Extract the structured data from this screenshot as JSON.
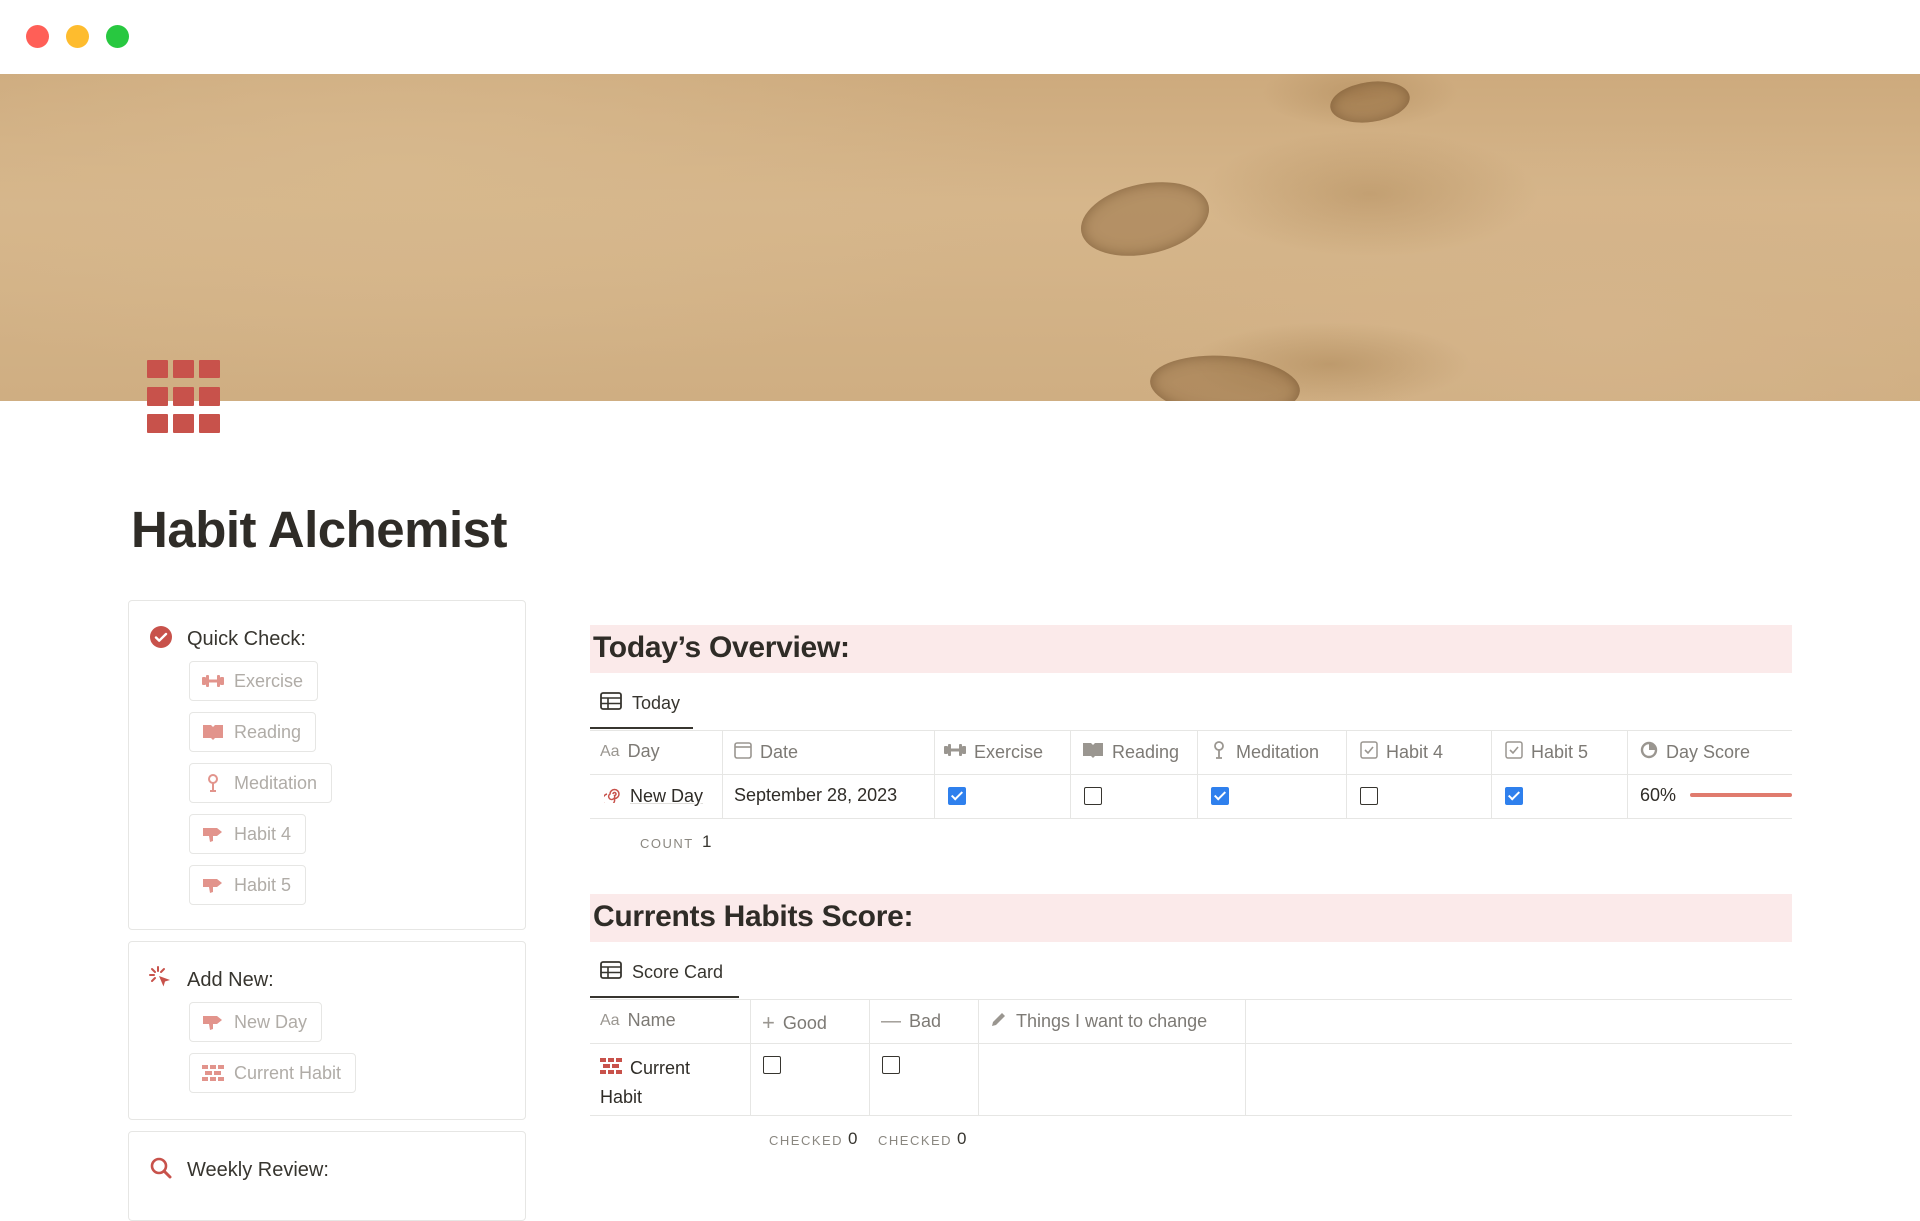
{
  "page": {
    "title": "Habit Alchemist"
  },
  "quick_check": {
    "heading": "Quick Check:",
    "buttons": [
      "Exercise",
      "Reading",
      "Meditation",
      "Habit 4",
      "Habit 5"
    ]
  },
  "add_new": {
    "heading": "Add New:",
    "buttons": [
      "New Day",
      "Current Habit"
    ]
  },
  "weekly_review": {
    "heading": "Weekly Review:"
  },
  "overview": {
    "heading": "Today’s Overview:",
    "tab_label": "Today",
    "columns": [
      {
        "label": "Day",
        "icon": "Aa"
      },
      {
        "label": "Date",
        "icon": "calendar-icon"
      },
      {
        "label": "Exercise",
        "icon": "dumbbell-icon"
      },
      {
        "label": "Reading",
        "icon": "book-icon"
      },
      {
        "label": "Meditation",
        "icon": "meditation-icon"
      },
      {
        "label": "Habit 4",
        "icon": "checkbox-icon"
      },
      {
        "label": "Habit 5",
        "icon": "checkbox-icon"
      },
      {
        "label": "Day Score",
        "icon": "progress-icon"
      }
    ],
    "row": {
      "day": "New Day",
      "date": "September 28, 2023",
      "exercise": true,
      "reading": false,
      "meditation": true,
      "habit4": false,
      "habit5": true,
      "day_score": "60%",
      "day_score_value": 0.6
    },
    "count_label": "COUNT",
    "count_value": "1"
  },
  "scores": {
    "heading": "Currents Habits Score:",
    "tab_label": "Score Card",
    "columns": [
      {
        "label": "Name",
        "icon": "Aa"
      },
      {
        "label": "Good",
        "icon": "plus-icon"
      },
      {
        "label": "Bad",
        "icon": "minus-icon"
      },
      {
        "label": "Things I want to change",
        "icon": "pencil-icon"
      }
    ],
    "row": {
      "name_line1": "Current",
      "name_line2": "Habit",
      "good": false,
      "bad": false
    },
    "checked_label": "CHECKED",
    "good_checked": "0",
    "bad_checked": "0"
  },
  "colors": {
    "accent": "#c8524b",
    "section_bg": "#fbeaea",
    "checkbox_on": "#2f80ed"
  }
}
